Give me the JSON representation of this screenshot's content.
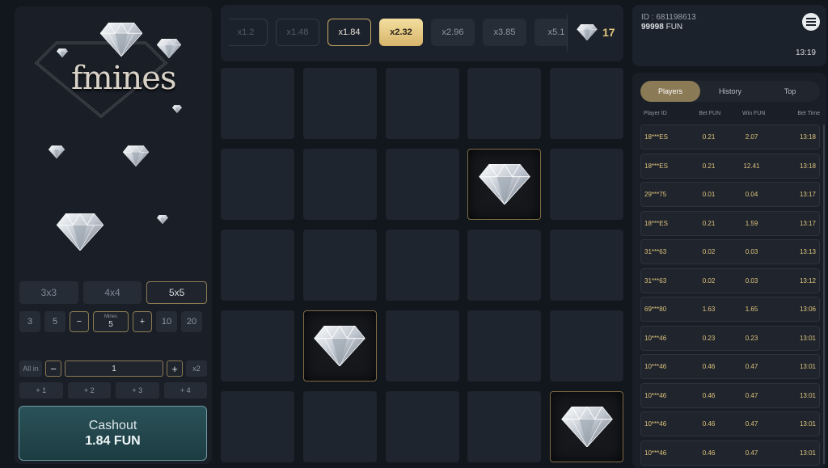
{
  "logo": {
    "text": "fmines"
  },
  "left": {
    "sizes": [
      "3x3",
      "4x4",
      "5x5"
    ],
    "active_size": "5x5",
    "mine_presets_left": [
      "3",
      "5"
    ],
    "mine_presets_right": [
      "10",
      "20"
    ],
    "minus": "−",
    "plus": "+",
    "mines_label": "Mines",
    "mines_value": "5",
    "bet_all_in": "All in",
    "bet_value": "1",
    "bet_x2": "x2",
    "add_buttons": [
      "+ 1",
      "+ 2",
      "+ 3",
      "+ 4"
    ],
    "cashout_label": "Cashout",
    "cashout_amount": "1.84  FUN"
  },
  "multipliers": {
    "items": [
      {
        "label": "x1.2",
        "state": "past"
      },
      {
        "label": "x1.48",
        "state": "past"
      },
      {
        "label": "x1.84",
        "state": "done"
      },
      {
        "label": "x2.32",
        "state": "current"
      },
      {
        "label": "x2.96",
        "state": "next"
      },
      {
        "label": "x3.85",
        "state": "next"
      },
      {
        "label": "x5.1",
        "state": "next"
      }
    ],
    "gems_left": "17"
  },
  "grid": {
    "rows": 5,
    "cols": 5,
    "revealed": [
      {
        "row": 1,
        "col": 3,
        "content": "diamond"
      },
      {
        "row": 3,
        "col": 1,
        "content": "diamond"
      },
      {
        "row": 4,
        "col": 4,
        "content": "diamond"
      }
    ]
  },
  "user": {
    "id": "ID : 681198613",
    "balance_value": "99998",
    "balance_unit": "FUN",
    "time": "13:19"
  },
  "players": {
    "tabs": [
      "Players",
      "History",
      "Top"
    ],
    "active_tab": "Players",
    "columns": [
      "Player ID",
      "Bet  FUN",
      "Win  FUN",
      "Bet Time"
    ],
    "rows": [
      [
        "18***ES",
        "0.21",
        "2.07",
        "13:18"
      ],
      [
        "18***ES",
        "0.21",
        "12.41",
        "13:18"
      ],
      [
        "29***75",
        "0.01",
        "0.04",
        "13:17"
      ],
      [
        "18***ES",
        "0.21",
        "1.59",
        "13:17"
      ],
      [
        "31***63",
        "0.02",
        "0.03",
        "13:13"
      ],
      [
        "31***63",
        "0.02",
        "0.03",
        "13:12"
      ],
      [
        "69***80",
        "1.63",
        "1.65",
        "13:06"
      ],
      [
        "10***46",
        "0.23",
        "0.23",
        "13:01"
      ],
      [
        "10***46",
        "0.46",
        "0.47",
        "13:01"
      ],
      [
        "10***46",
        "0.46",
        "0.47",
        "13:01"
      ],
      [
        "10***46",
        "0.46",
        "0.47",
        "13:01"
      ],
      [
        "10***46",
        "0.46",
        "0.47",
        "13:01"
      ]
    ]
  },
  "colors": {
    "accent_gold": "#e0c47c",
    "cashout_teal": "#2a5258",
    "background": "#12161d"
  }
}
